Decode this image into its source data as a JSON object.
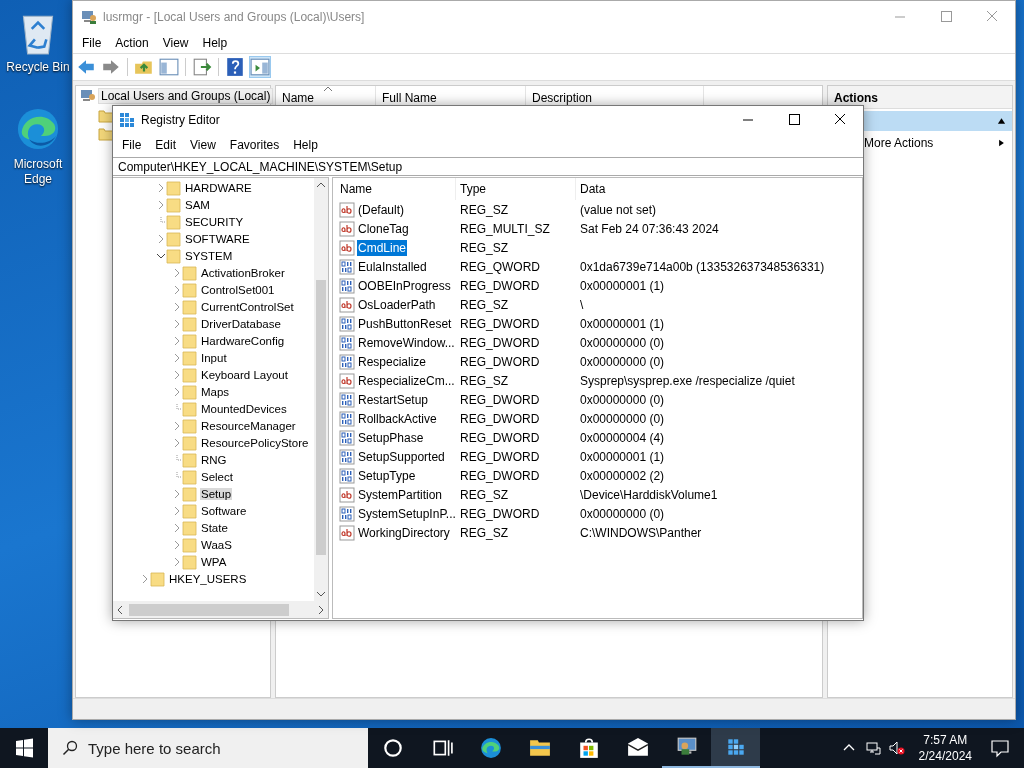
{
  "desktop_icons": [
    {
      "label": "Recycle Bin",
      "kind": "recycle"
    },
    {
      "label": "Microsoft Edge",
      "kind": "edge"
    }
  ],
  "lusrmgr": {
    "title": "lusrmgr - [Local Users and Groups (Local)\\Users]",
    "menu": [
      "File",
      "Action",
      "View",
      "Help"
    ],
    "tree_root": "Local Users and Groups (Local)",
    "columns": [
      {
        "label": "Name",
        "sorted": true
      },
      {
        "label": "Full Name",
        "sorted": false
      },
      {
        "label": "Description",
        "sorted": false
      }
    ],
    "actions_header": "Actions",
    "more_actions": "More Actions"
  },
  "regedit": {
    "title": "Registry Editor",
    "menu": [
      "File",
      "Edit",
      "View",
      "Favorites",
      "Help"
    ],
    "address": "Computer\\HKEY_LOCAL_MACHINE\\SYSTEM\\Setup",
    "tree": [
      {
        "children": [
          {
            "label": "HARDWARE",
            "expandable": true,
            "expanded": false,
            "selected": false
          },
          {
            "label": "SAM",
            "expandable": true,
            "expanded": false,
            "selected": false
          },
          {
            "label": "SECURITY",
            "expandable": false,
            "expanded": false,
            "selected": false
          },
          {
            "label": "SOFTWARE",
            "expandable": true,
            "expanded": false,
            "selected": false
          },
          {
            "label": "SYSTEM",
            "expandable": true,
            "expanded": true,
            "selected": false,
            "children": [
              {
                "label": "ActivationBroker",
                "expandable": true,
                "expanded": false,
                "selected": false
              },
              {
                "label": "ControlSet001",
                "expandable": true,
                "expanded": false,
                "selected": false
              },
              {
                "label": "CurrentControlSet",
                "expandable": true,
                "expanded": false,
                "selected": false
              },
              {
                "label": "DriverDatabase",
                "expandable": true,
                "expanded": false,
                "selected": false
              },
              {
                "label": "HardwareConfig",
                "expandable": true,
                "expanded": false,
                "selected": false
              },
              {
                "label": "Input",
                "expandable": true,
                "expanded": false,
                "selected": false
              },
              {
                "label": "Keyboard Layout",
                "expandable": true,
                "expanded": false,
                "selected": false
              },
              {
                "label": "Maps",
                "expandable": true,
                "expanded": false,
                "selected": false
              },
              {
                "label": "MountedDevices",
                "expandable": false,
                "expanded": false,
                "selected": false
              },
              {
                "label": "ResourceManager",
                "expandable": true,
                "expanded": false,
                "selected": false
              },
              {
                "label": "ResourcePolicyStore",
                "expandable": true,
                "expanded": false,
                "selected": false
              },
              {
                "label": "RNG",
                "expandable": false,
                "expanded": false,
                "selected": false
              },
              {
                "label": "Select",
                "expandable": false,
                "expanded": false,
                "selected": false
              },
              {
                "label": "Setup",
                "expandable": true,
                "expanded": false,
                "selected": true
              },
              {
                "label": "Software",
                "expandable": true,
                "expanded": false,
                "selected": false
              },
              {
                "label": "State",
                "expandable": true,
                "expanded": false,
                "selected": false
              },
              {
                "label": "WaaS",
                "expandable": true,
                "expanded": false,
                "selected": false
              },
              {
                "label": "WPA",
                "expandable": true,
                "expanded": false,
                "selected": false
              }
            ]
          }
        ]
      },
      {
        "label": "HKEY_USERS",
        "expandable": true,
        "expanded": false,
        "selected": false
      }
    ],
    "columns": [
      "Name",
      "Type",
      "Data"
    ],
    "values": [
      {
        "name": "(Default)",
        "type": "REG_SZ",
        "data": "(value not set)",
        "kind": "string",
        "selected": false
      },
      {
        "name": "CloneTag",
        "type": "REG_MULTI_SZ",
        "data": "Sat Feb 24 07:36:43 2024",
        "kind": "string",
        "selected": false
      },
      {
        "name": "CmdLine",
        "type": "REG_SZ",
        "kind": "string",
        "selected": true
      },
      {
        "name": "EulaInstalled",
        "type": "REG_QWORD",
        "data": "0x1da6739e714a00b (133532637348536331)",
        "kind": "binary",
        "selected": false
      },
      {
        "name": "OOBEInProgress",
        "type": "REG_DWORD",
        "data": "0x00000001 (1)",
        "kind": "binary",
        "selected": false
      },
      {
        "name": "OsLoaderPath",
        "type": "REG_SZ",
        "data": "\\",
        "kind": "string",
        "selected": false
      },
      {
        "name": "PushButtonReset",
        "type": "REG_DWORD",
        "data": "0x00000001 (1)",
        "kind": "binary",
        "selected": false
      },
      {
        "name": "RemoveWindow...",
        "type": "REG_DWORD",
        "data": "0x00000000 (0)",
        "kind": "binary",
        "selected": false
      },
      {
        "name": "Respecialize",
        "type": "REG_DWORD",
        "data": "0x00000000 (0)",
        "kind": "binary",
        "selected": false
      },
      {
        "name": "RespecializeCm...",
        "type": "REG_SZ",
        "data": "Sysprep\\sysprep.exe /respecialize /quiet",
        "kind": "string",
        "selected": false
      },
      {
        "name": "RestartSetup",
        "type": "REG_DWORD",
        "data": "0x00000000 (0)",
        "kind": "binary",
        "selected": false
      },
      {
        "name": "RollbackActive",
        "type": "REG_DWORD",
        "data": "0x00000000 (0)",
        "kind": "binary",
        "selected": false
      },
      {
        "name": "SetupPhase",
        "type": "REG_DWORD",
        "data": "0x00000004 (4)",
        "kind": "binary",
        "selected": false
      },
      {
        "name": "SetupSupported",
        "type": "REG_DWORD",
        "data": "0x00000001 (1)",
        "kind": "binary",
        "selected": false
      },
      {
        "name": "SetupType",
        "type": "REG_DWORD",
        "data": "0x00000002 (2)",
        "kind": "binary",
        "selected": false
      },
      {
        "name": "SystemPartition",
        "type": "REG_SZ",
        "data": "\\Device\\HarddiskVolume1",
        "kind": "string",
        "selected": false
      },
      {
        "name": "SystemSetupInP...",
        "type": "REG_DWORD",
        "data": "0x00000000 (0)",
        "kind": "binary",
        "selected": false
      },
      {
        "name": "WorkingDirectory",
        "type": "REG_SZ",
        "data": "C:\\WINDOWS\\Panther",
        "kind": "string",
        "selected": false
      }
    ]
  },
  "taskbar": {
    "search_placeholder": "Type here to search",
    "apps": [
      {
        "kind": "cortana",
        "open": false,
        "active": false
      },
      {
        "kind": "taskview",
        "open": false,
        "active": false
      },
      {
        "kind": "edge",
        "open": false,
        "active": false
      },
      {
        "kind": "explorer",
        "open": false,
        "active": false
      },
      {
        "kind": "store",
        "open": false,
        "active": false
      },
      {
        "kind": "mail",
        "open": false,
        "active": false
      },
      {
        "kind": "computer",
        "open": true,
        "active": false
      },
      {
        "kind": "registry",
        "open": true,
        "active": true
      }
    ],
    "time": "7:57 AM",
    "date": "2/24/2024"
  }
}
